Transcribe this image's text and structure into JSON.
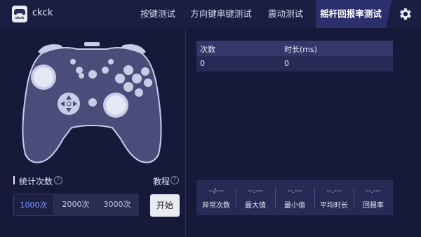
{
  "app": {
    "title": "ckck",
    "logo_text": "ckck"
  },
  "tabs": [
    {
      "label": "按键测试",
      "active": false
    },
    {
      "label": "方向键串键测试",
      "active": false
    },
    {
      "label": "震动测试",
      "active": false
    },
    {
      "label": "摇杆回报率测试",
      "active": true
    }
  ],
  "icons": {
    "settings": "gear-icon",
    "help": "question-circle-icon",
    "logo": "gamepad-icon"
  },
  "left_panel": {
    "count_label": "统计次数",
    "tutorial_label": "教程",
    "help_glyph": "?",
    "count_options": [
      {
        "label": "1000次",
        "selected": true
      },
      {
        "label": "2000次",
        "selected": false
      },
      {
        "label": "3000次",
        "selected": false
      }
    ],
    "start_label": "开始"
  },
  "table": {
    "headers": [
      "次数",
      "时长(ms)"
    ],
    "rows": [
      [
        "0",
        "0"
      ]
    ]
  },
  "stats": [
    {
      "value": "--/---",
      "label": "异常次数"
    },
    {
      "value": "--.---",
      "label": "最大值"
    },
    {
      "value": "--.---",
      "label": "最小值"
    },
    {
      "value": "--.---",
      "label": "平均时长"
    },
    {
      "value": "--.---",
      "label": "回报率"
    }
  ],
  "colors": {
    "background": "#16193a",
    "active_tab": "#2c2f6e",
    "accent_text": "#7e9bff"
  }
}
